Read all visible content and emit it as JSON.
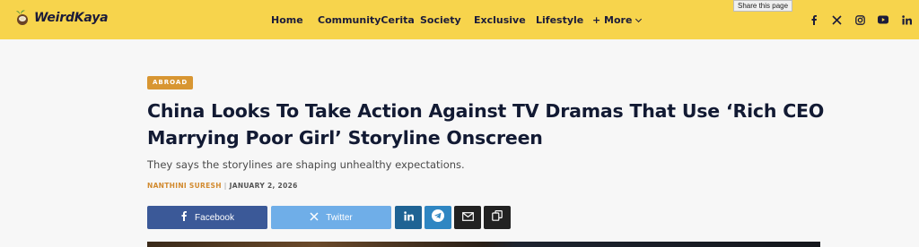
{
  "header": {
    "logo_text": "WeirdKaya",
    "nav": [
      "Home",
      "CommunityCerita",
      "Society",
      "Exclusive",
      "Lifestyle",
      "+ More"
    ],
    "socials": [
      "facebook-icon",
      "x-icon",
      "instagram-icon",
      "youtube-icon",
      "linkedin-icon"
    ],
    "bg_color": "#f7d44c",
    "tooltip": "Share this page"
  },
  "article": {
    "category": "ABROAD",
    "title": "China Looks To Take Action Against TV Dramas That Use ‘Rich CEO Marrying Poor Girl’ Storyline Onscreen",
    "subtitle": "They says the storylines are shaping unhealthy expectations.",
    "author": "NANTHINI SURESH",
    "separator": "|",
    "date": "JANUARY 2, 2026"
  },
  "share": {
    "facebook_label": "Facebook",
    "twitter_label": "Twitter",
    "colors": {
      "facebook": "#3b5998",
      "twitter": "#6faee8",
      "linkedin": "#1f6394",
      "telegram": "#2f86c2",
      "email": "#222222",
      "copy": "#222222"
    },
    "icons": [
      "facebook-icon",
      "x-icon",
      "linkedin-icon",
      "telegram-icon",
      "email-icon",
      "copy-icon"
    ]
  }
}
